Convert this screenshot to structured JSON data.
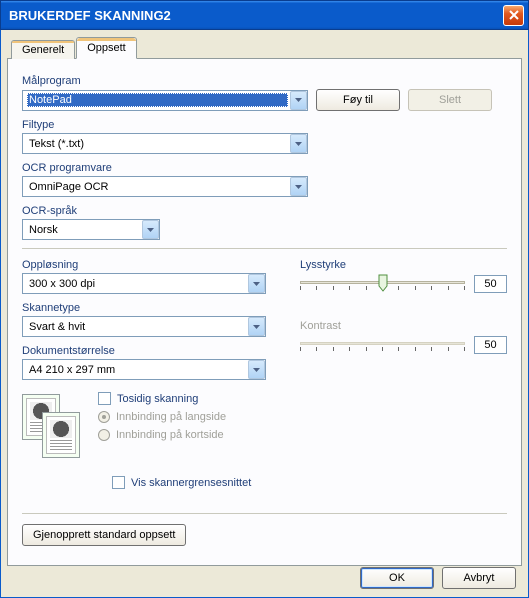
{
  "window": {
    "title": "BRUKERDEF SKANNING2"
  },
  "tabs": {
    "general": "Generelt",
    "setup": "Oppsett"
  },
  "labels": {
    "target_app": "Målprogram",
    "file_type": "Filtype",
    "ocr_software": "OCR programvare",
    "ocr_language": "OCR-språk",
    "resolution": "Oppløsning",
    "scan_type": "Skannetype",
    "document_size": "Dokumentstørrelse",
    "brightness": "Lysstyrke",
    "contrast": "Kontrast"
  },
  "selects": {
    "target_app": "NotePad",
    "file_type": "Tekst (*.txt)",
    "ocr_software": "OmniPage OCR",
    "ocr_language": "Norsk",
    "resolution": "300 x 300 dpi",
    "scan_type": "Svart & hvit",
    "document_size": "A4 210 x 297 mm"
  },
  "buttons": {
    "add": "Føy til",
    "delete": "Slett",
    "restore_defaults": "Gjenopprett standard oppsett",
    "ok": "OK",
    "cancel": "Avbryt"
  },
  "checks": {
    "duplex": "Tosidig skanning",
    "bind_long": "Innbinding på langside",
    "bind_short": "Innbinding på kortside",
    "show_scanner_ui": "Vis skannergrensesnittet"
  },
  "sliders": {
    "brightness": "50",
    "contrast": "50"
  }
}
